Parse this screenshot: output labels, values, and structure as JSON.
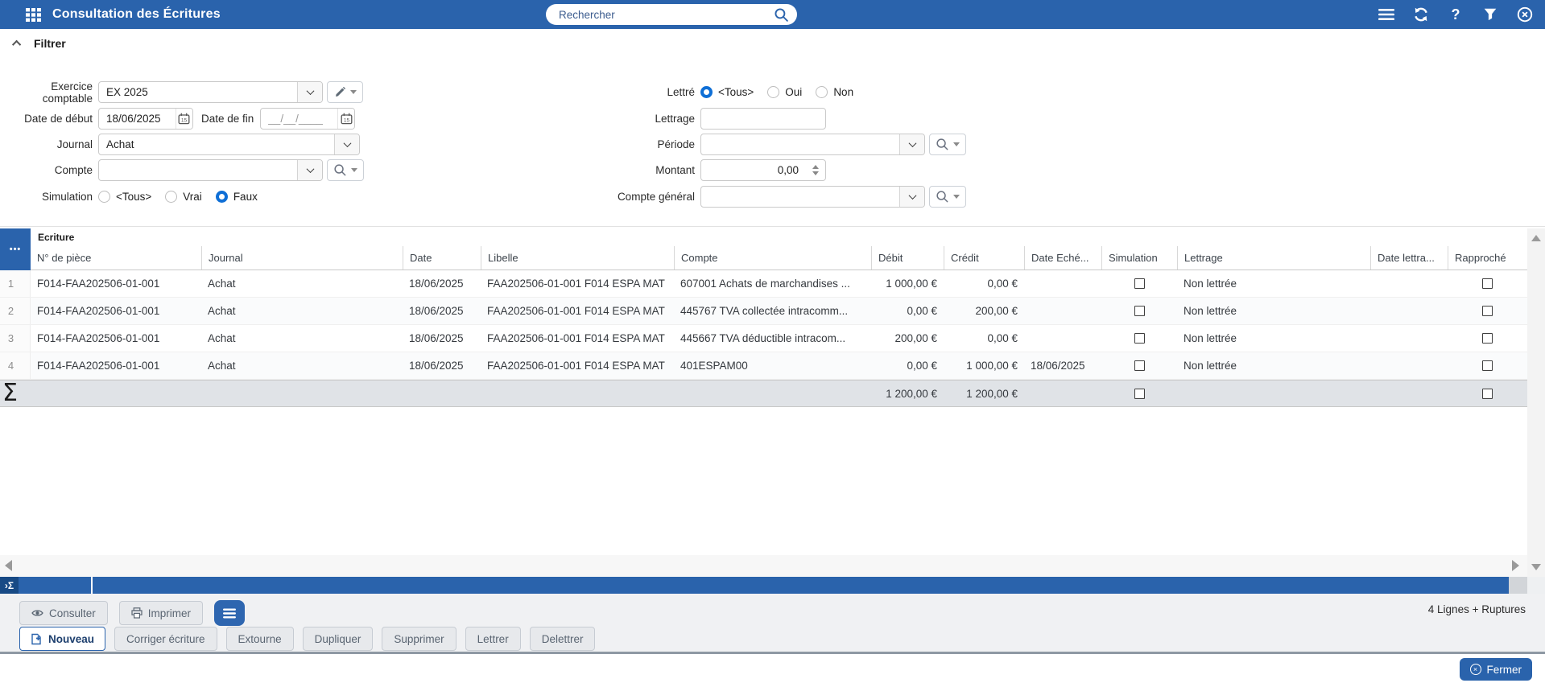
{
  "header": {
    "title": "Consultation des Écritures",
    "search_placeholder": "Rechercher",
    "accent_color": "#2a63ac"
  },
  "icons": {
    "corner_ellipsis": "•••",
    "sigma": "Σ",
    "sum_bar": "›Σ",
    "help": "?"
  },
  "filter": {
    "title": "Filtrer",
    "fields": {
      "exercice": {
        "label": "Exercice comptable",
        "value": "EX 2025"
      },
      "date_debut": {
        "label": "Date de début",
        "value": "18/06/2025"
      },
      "date_fin": {
        "label": "Date de fin",
        "value": "__/__/____"
      },
      "journal": {
        "label": "Journal",
        "value": "Achat"
      },
      "compte": {
        "label": "Compte",
        "value": ""
      },
      "simulation": {
        "label": "Simulation",
        "options": [
          "<Tous>",
          "Vrai",
          "Faux"
        ],
        "selected": "Faux"
      },
      "lettre": {
        "label": "Lettré",
        "options": [
          "<Tous>",
          "Oui",
          "Non"
        ],
        "selected": "<Tous>"
      },
      "lettrage": {
        "label": "Lettrage",
        "value": ""
      },
      "periode": {
        "label": "Période",
        "value": ""
      },
      "montant": {
        "label": "Montant",
        "value": "0,00"
      },
      "compte_general": {
        "label": "Compte général",
        "value": ""
      }
    }
  },
  "table": {
    "group_header": "Ecriture",
    "columns": [
      "N° de pièce",
      "Journal",
      "Date",
      "Libelle",
      "Compte",
      "Débit",
      "Crédit",
      "Date Eché...",
      "Simulation",
      "Lettrage",
      "Date lettra...",
      "Rapproché"
    ],
    "rows": [
      {
        "num": "1",
        "piece": "F014-FAA202506-01-001",
        "journal": "Achat",
        "date": "18/06/2025",
        "libelle": "FAA202506-01-001 F014 ESPA MAT",
        "compte": "607001 Achats de marchandises ...",
        "debit": "1 000,00 €",
        "credit": "0,00 €",
        "date_echeance": "",
        "lettrage": "Non lettrée",
        "date_lettrage": ""
      },
      {
        "num": "2",
        "piece": "F014-FAA202506-01-001",
        "journal": "Achat",
        "date": "18/06/2025",
        "libelle": "FAA202506-01-001 F014 ESPA MAT",
        "compte": "445767 TVA collectée intracomm...",
        "debit": "0,00 €",
        "credit": "200,00 €",
        "date_echeance": "",
        "lettrage": "Non lettrée",
        "date_lettrage": ""
      },
      {
        "num": "3",
        "piece": "F014-FAA202506-01-001",
        "journal": "Achat",
        "date": "18/06/2025",
        "libelle": "FAA202506-01-001 F014 ESPA MAT",
        "compte": "445667 TVA déductible intracom...",
        "debit": "200,00 €",
        "credit": "0,00 €",
        "date_echeance": "",
        "lettrage": "Non lettrée",
        "date_lettrage": ""
      },
      {
        "num": "4",
        "piece": "F014-FAA202506-01-001",
        "journal": "Achat",
        "date": "18/06/2025",
        "libelle": "FAA202506-01-001 F014 ESPA MAT",
        "compte": "401ESPAM00",
        "debit": "0,00 €",
        "credit": "1 000,00 €",
        "date_echeance": "18/06/2025",
        "lettrage": "Non lettrée",
        "date_lettrage": ""
      }
    ],
    "summary": {
      "debit": "1 200,00 €",
      "credit": "1 200,00 €"
    }
  },
  "toolbar": {
    "consulter": "Consulter",
    "imprimer": "Imprimer",
    "nouveau": "Nouveau",
    "corriger": "Corriger écriture",
    "extourne": "Extourne",
    "dupliquer": "Dupliquer",
    "supprimer": "Supprimer",
    "lettrer": "Lettrer",
    "delettrer": "Delettrer",
    "lines_info": "4 Lignes + Ruptures"
  },
  "footer": {
    "fermer": "Fermer"
  }
}
